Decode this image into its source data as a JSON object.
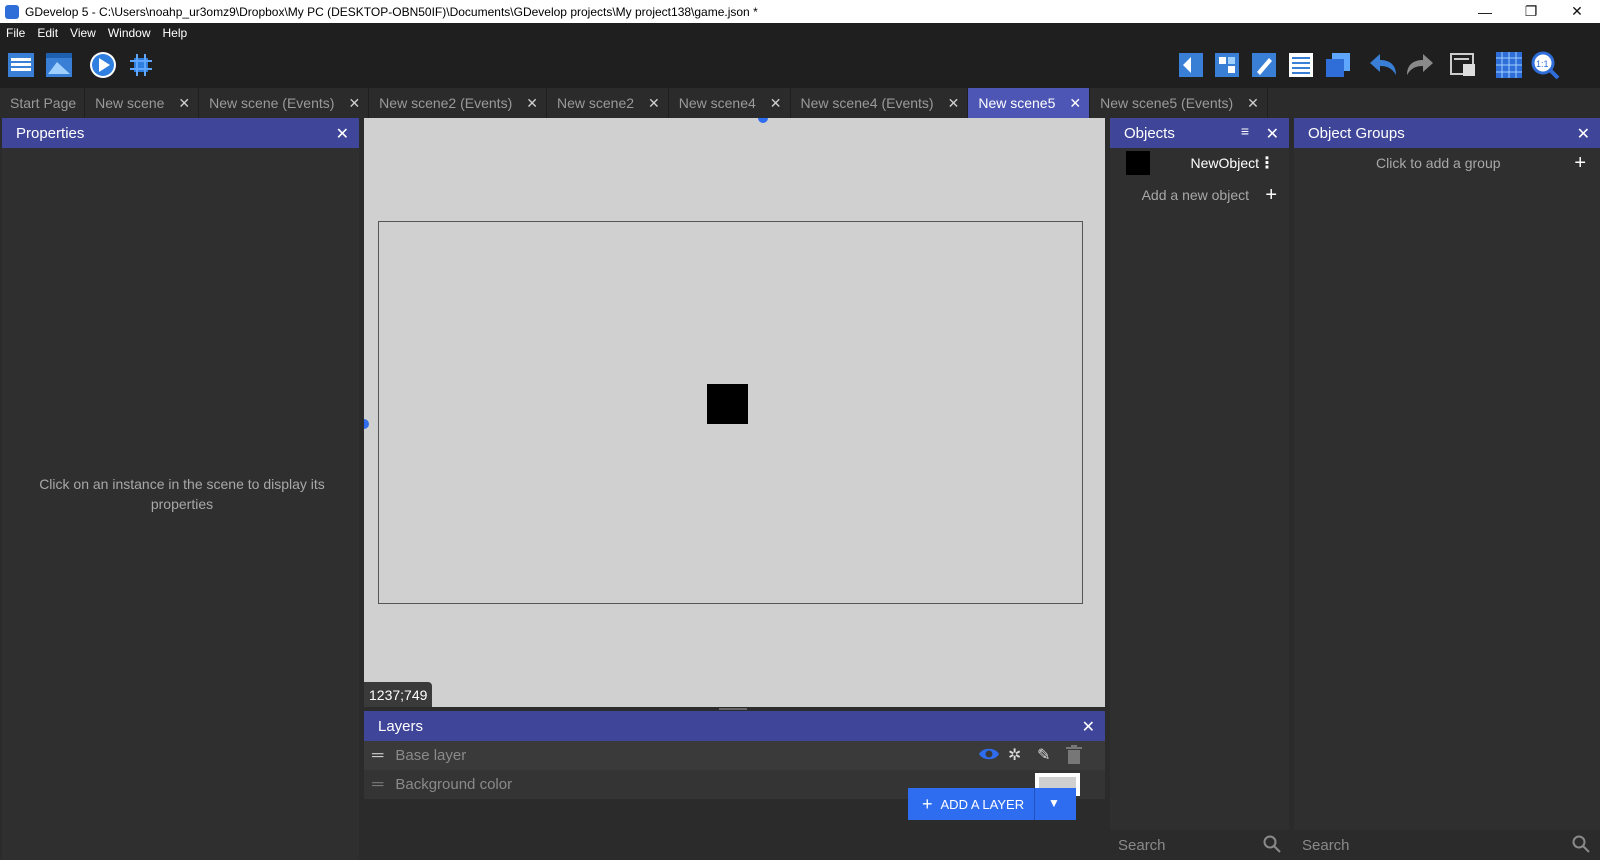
{
  "window": {
    "title": "GDevelop 5 - C:\\Users\\noahp_ur3omz9\\Dropbox\\My PC (DESKTOP-OBN50IF)\\Documents\\GDevelop projects\\My project138\\game.json *",
    "minimize": "—",
    "restore": "❐",
    "close": "✕"
  },
  "menu": [
    "File",
    "Edit",
    "View",
    "Window",
    "Help"
  ],
  "toolbar": {
    "left_icons": [
      "project-manager-icon",
      "scene-editor-icon",
      "preview-play-icon",
      "debugger-icon"
    ],
    "right_icons": [
      "object-icon",
      "object-groups-icon",
      "properties-icon",
      "instances-list-icon",
      "layers-icon",
      "undo-icon",
      "redo-icon",
      "layer-window-icon",
      "grid-icon",
      "zoom-icon"
    ]
  },
  "tabs": [
    {
      "label": "Start Page",
      "closable": false
    },
    {
      "label": "New scene",
      "closable": true
    },
    {
      "label": "New scene (Events)",
      "closable": true
    },
    {
      "label": "New scene2 (Events)",
      "closable": true
    },
    {
      "label": "New scene2",
      "closable": true
    },
    {
      "label": "New scene4",
      "closable": true
    },
    {
      "label": "New scene4 (Events)",
      "closable": true
    },
    {
      "label": "New scene5",
      "closable": true,
      "active": true
    },
    {
      "label": "New scene5 (Events)",
      "closable": true
    }
  ],
  "properties": {
    "title": "Properties",
    "hint": "Click on an instance in the scene to display its properties"
  },
  "canvas": {
    "coords": "1237;749"
  },
  "layers": {
    "title": "Layers",
    "base_layer": "Base layer",
    "background_color": "Background color",
    "add_layer": "ADD A LAYER"
  },
  "objects": {
    "title": "Objects",
    "item_name": "NewObject",
    "add_new": "Add a new object",
    "search_placeholder": "Search"
  },
  "groups": {
    "title": "Object Groups",
    "add_group": "Click to add a group",
    "search_placeholder": "Search"
  },
  "colors": {
    "accent": "#3f4598",
    "active_tab": "#4d56b4",
    "button_blue": "#2f6df0",
    "canvas": "#d0d0d0"
  }
}
